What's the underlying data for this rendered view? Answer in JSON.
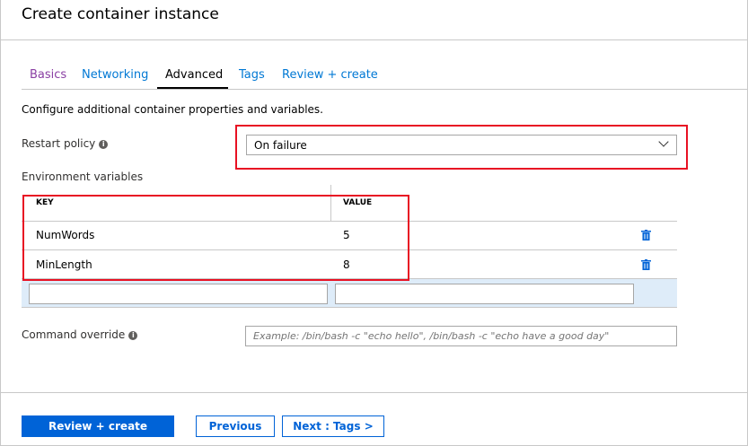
{
  "header": {
    "title": "Create container instance"
  },
  "tabs": [
    {
      "label": "Basics"
    },
    {
      "label": "Networking"
    },
    {
      "label": "Advanced"
    },
    {
      "label": "Tags"
    },
    {
      "label": "Review + create"
    }
  ],
  "description": "Configure additional container properties and variables.",
  "restart_policy": {
    "label": "Restart policy",
    "value": "On failure"
  },
  "env": {
    "label": "Environment variables",
    "headers": {
      "key": "KEY",
      "value": "VALUE"
    },
    "rows": [
      {
        "key": "NumWords",
        "value": "5"
      },
      {
        "key": "MinLength",
        "value": "8"
      }
    ],
    "new_key": "",
    "new_value": ""
  },
  "command_override": {
    "label": "Command override",
    "value": "",
    "placeholder": "Example: /bin/bash -c \"echo hello\", /bin/bash -c \"echo have a good day\""
  },
  "footer": {
    "review_create": "Review + create",
    "previous": "Previous",
    "next": "Next : Tags >"
  },
  "colors": {
    "accent": "#0063d7",
    "highlight": "#e81123",
    "new_row_bg": "#deecf9"
  }
}
